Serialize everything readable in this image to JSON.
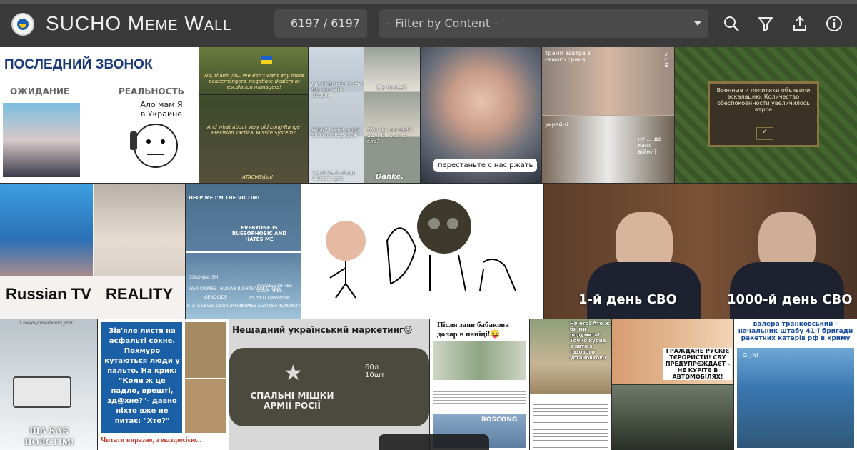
{
  "header": {
    "title": "SUCHO Meme Wall",
    "counter": "6197 / 6197",
    "filter_placeholder": "– Filter by Content –"
  },
  "icons": [
    "sucho-logo",
    "search-icon",
    "filter-icon",
    "upload-icon",
    "info-icon"
  ],
  "memes": {
    "m1": {
      "title": "ПОСЛЕДНИЙ ЗВОНОК",
      "left": "ОЖИДАНИЕ",
      "right": "РЕАЛЬНОСТЬ",
      "speech": "Ало мам Я в Украине"
    },
    "m2": {
      "t1": "No, thank you. We don't want any more peacemongers, negotiate-dealers or escalation managers!",
      "t2": "And what about very old Long-Range Precision Tactical Missile System?",
      "t3": "ATACMSdsn!"
    },
    "m3": {
      "a": "I want Russia to end the war with Ukraine",
      "b": "Be honest.",
      "c": "What? I want a just and lasting peace!",
      "d": "Why do you really want the war to end?",
      "e": "I just want cheap Russian gas.",
      "f": "Danke."
    },
    "m4": {
      "caption": "перестаньте с нас ржать"
    },
    "m5": {
      "top": "трамп завтра з самого сраня:",
      "bottom_left": "украйці:",
      "bottom_right": "ну ... де канс війни?",
      "wm": "G◌NI"
    },
    "m6": {
      "text": "Военные и политики объявили эскалацию. Количество обеспокоенности увеличилось втрое",
      "mark": "✓"
    },
    "m7": {
      "left": "Russian TV",
      "right": "REALITY"
    },
    "m8": {
      "a": "HELP ME I'M THE VICTIM!",
      "b": "EVERYONE IS RUSSOPHOBIC AND HATES ME",
      "c1": "COLONIALISM",
      "c2": "WAR CRIMES",
      "c3": "HUMAN RIGHTS VIOLATIONS",
      "c4": "GENOCIDE",
      "c5": "STATE LEVEL CORRUPTION",
      "c6": "CRIMES AGAINST HUMANITY",
      "c7": "INVADES OTHER COUNTRIES",
      "c8": "POLITICAL OPPOSITION"
    },
    "m10": {
      "left": "1-й день СВО",
      "right": "1000-й день СВО"
    },
    "m11": {
      "caption": "ЩА КАК ПОЛСТІМ!",
      "wm": "t.me/mytimerbonks_mor"
    },
    "m12": {
      "text": "Зів'яле листя на асфальті сохне. Похмуро кутаються люди у пальто. На крик: \"Коли ж це падло, врешті, зд@хне?\"- давно ніхто вже не питає: \"Хто?\"",
      "caption": "Читати виразно, з експресією..."
    },
    "m13": {
      "title": "Нещадний український маркетинг😜",
      "bag": "СПАЛЬНІ МІШКИ АРМІЇ РОСІЇ",
      "size": "60л 10шт"
    },
    "m14": {
      "title": "Після заяв бабакова долар в паніці!😜",
      "brand": "ROSCONG"
    },
    "m15": {
      "text": "Нічого! Ато ж би ми подумить! Точно курив в авто з газового установкою!"
    },
    "m16": {
      "text": "ГРАЖДАНЕ РУСКІЄ ТЄРОРИСТИ! СБУ ПРЕДУПРЄЖДАЄТ - НЕ КУРІТЄ В АВТОМОБІЛЯХ!"
    },
    "m17": {
      "title": "валера транковський - начальник штабу 41-ї бригади ракетних катерів рф в криму",
      "wm": "G◌NI"
    }
  }
}
